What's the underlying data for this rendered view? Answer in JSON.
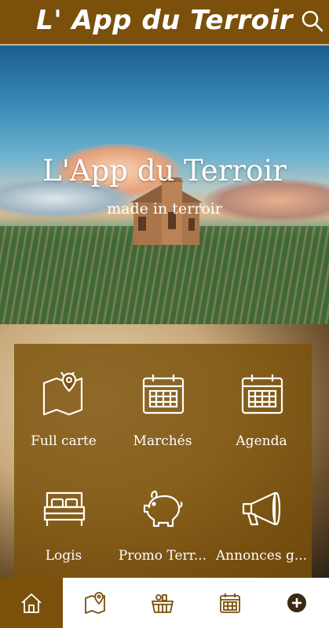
{
  "header": {
    "title": "L' App du Terroir",
    "search_icon": "search-icon"
  },
  "hero": {
    "title": "L'App du Terroir",
    "subtitle": "made in terroir"
  },
  "menu": {
    "items": [
      {
        "label": "Full carte",
        "icon": "map-pin-icon"
      },
      {
        "label": "Marchés",
        "icon": "calendar-icon"
      },
      {
        "label": "Agenda",
        "icon": "calendar-icon"
      },
      {
        "label": "Logis",
        "icon": "bed-icon"
      },
      {
        "label": "Promo Terr...",
        "icon": "piggy-bank-icon"
      },
      {
        "label": "Annonces g...",
        "icon": "megaphone-icon"
      }
    ]
  },
  "bottom_nav": {
    "items": [
      {
        "icon": "home-icon",
        "active": true
      },
      {
        "icon": "map-pin-icon",
        "active": false
      },
      {
        "icon": "basket-icon",
        "active": false
      },
      {
        "icon": "calendar-icon",
        "active": false
      },
      {
        "icon": "plus-circle-icon",
        "active": false
      }
    ]
  },
  "colors": {
    "primary": "#7a500a",
    "text_light": "#ffffff"
  }
}
